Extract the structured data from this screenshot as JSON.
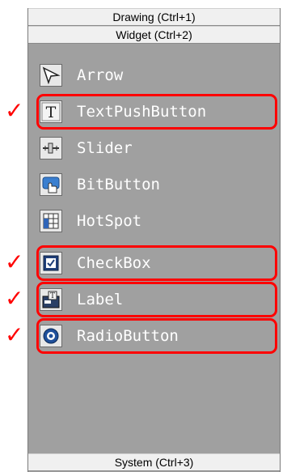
{
  "headers": {
    "drawing": "Drawing (Ctrl+1)",
    "widget": "Widget (Ctrl+2)",
    "system": "System (Ctrl+3)"
  },
  "widgets": [
    {
      "label": "Arrow",
      "icon": "arrow-cursor-icon",
      "checked": false
    },
    {
      "label": "TextPushButton",
      "icon": "text-t-icon",
      "checked": true
    },
    {
      "label": "Slider",
      "icon": "slider-icon",
      "checked": false
    },
    {
      "label": "BitButton",
      "icon": "bit-button-icon",
      "checked": false
    },
    {
      "label": "HotSpot",
      "icon": "hotspot-icon",
      "checked": false
    },
    {
      "label": "CheckBox",
      "icon": "checkbox-icon",
      "checked": true
    },
    {
      "label": "Label",
      "icon": "label-icon",
      "checked": true
    },
    {
      "label": "RadioButton",
      "icon": "radio-button-icon",
      "checked": true
    }
  ],
  "annotation": {
    "mark": "✓",
    "color": "#ff0000"
  },
  "colors": {
    "panel_bg": "#a0a0a0",
    "header_bg": "#f0f0f0",
    "item_text": "#ffffff"
  }
}
